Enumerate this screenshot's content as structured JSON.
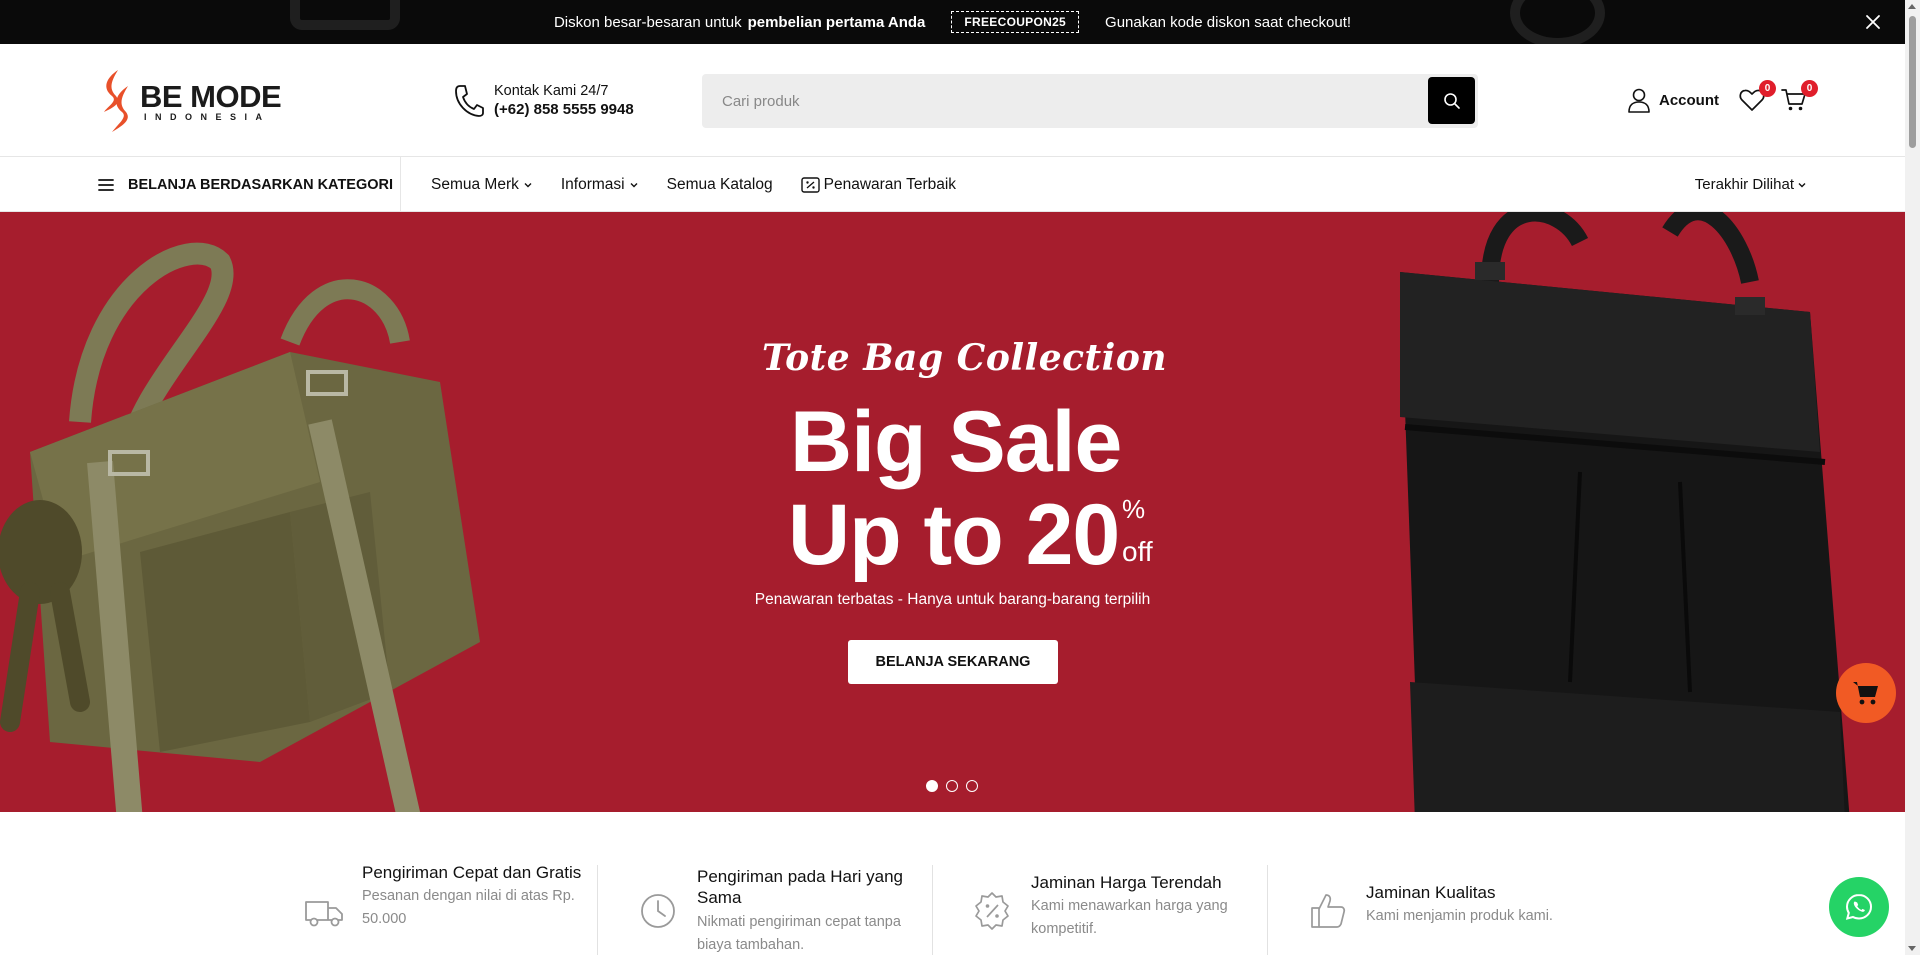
{
  "announcement": {
    "text_before": "Diskon besar-besaran untuk",
    "text_bold": "pembelian pertama Anda",
    "coupon_code": "FREECOUPON25",
    "text_after": "Gunakan kode diskon saat checkout!",
    "close_icon": "close-icon"
  },
  "header": {
    "logo": {
      "name": "BE MODE",
      "tagline": "INDONESIA",
      "mark_color": "#e8502a"
    },
    "contact": {
      "label": "Kontak Kami 24/7",
      "phone": "(+62) 858 5555 9948",
      "icon": "phone-icon"
    },
    "search": {
      "placeholder": "Cari produk",
      "value": "",
      "icon": "search-icon"
    },
    "account_label": "Account",
    "wishlist_count": "0",
    "cart_count": "0"
  },
  "nav": {
    "categories_label": "BELANJA BERDASARKAN KATEGORI",
    "links": [
      {
        "label": "Semua Merk",
        "dropdown": true
      },
      {
        "label": "Informasi",
        "dropdown": true
      },
      {
        "label": "Semua Katalog",
        "dropdown": false
      },
      {
        "label": "Penawaran Terbaik",
        "dropdown": false,
        "icon": "discount-icon"
      }
    ],
    "recent_label": "Terakhir Dilihat"
  },
  "hero": {
    "script_title": "Tote Bag Collection",
    "headline_line1": "Big Sale",
    "headline_line2": "Up to 20",
    "percent_sign": "%",
    "off_text": "off",
    "subtitle": "Penawaran terbatas - Hanya untuk barang-barang terpilih",
    "cta_label": "BELANJA SEKARANG",
    "background_color": "#a61d2d",
    "slides_total": 3,
    "active_slide": 1
  },
  "features": [
    {
      "title": "Pengiriman Cepat dan Gratis",
      "desc": "Pesanan dengan nilai di atas Rp. 50.000",
      "icon": "delivery-truck-icon"
    },
    {
      "title": "Pengiriman pada Hari yang Sama",
      "desc": "Nikmati pengiriman cepat tanpa biaya tambahan.",
      "icon": "clock-icon"
    },
    {
      "title": "Jaminan Harga Terendah",
      "desc": "Kami menawarkan harga yang kompetitif.",
      "icon": "discount-badge-icon"
    },
    {
      "title": "Jaminan Kualitas",
      "desc": "Kami menjamin produk kami.",
      "icon": "thumbs-up-icon"
    }
  ],
  "floating": {
    "cart_color": "#f15a24",
    "whatsapp_color": "#25d366"
  }
}
